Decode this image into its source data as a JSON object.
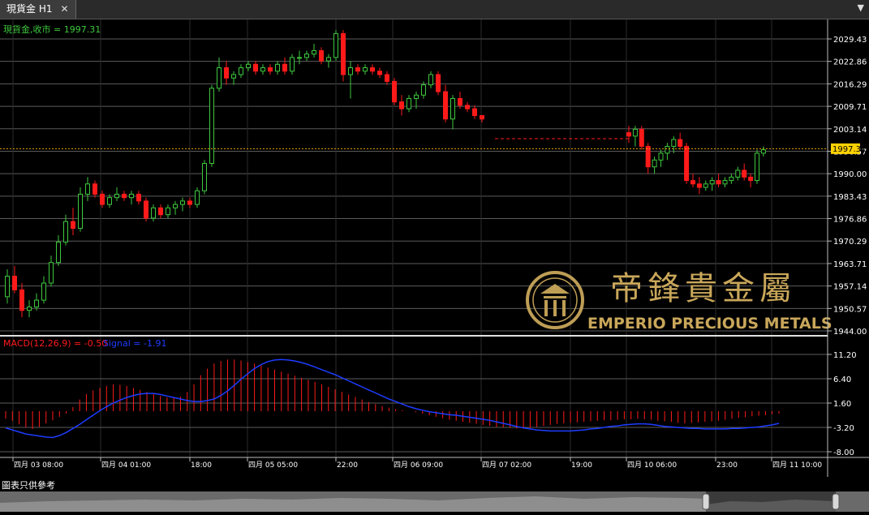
{
  "tab": {
    "title": "現貨金 H1",
    "close_glyph": "✕",
    "menu_glyph": "▼"
  },
  "main_label": "現貨金,收市 = 1997.31",
  "macd_label": {
    "name": "MACD(12,26,9) = -0.50",
    "signal": "Signal = -1.91"
  },
  "last_price_label": "1997.31",
  "price_ticks": [
    "2029.43",
    "2022.86",
    "2016.29",
    "2009.71",
    "2003.14",
    "1996.57",
    "1990.00",
    "1983.43",
    "1976.86",
    "1970.29",
    "1963.71",
    "1957.14",
    "1950.57",
    "1944.00"
  ],
  "macd_ticks": [
    "11.20",
    "6.40",
    "1.60",
    "-3.20",
    "-8.00"
  ],
  "time_labels": [
    "四月 03 08:00",
    "四月 04 01:00",
    "18:00",
    "四月 05 05:00",
    "22:00",
    "四月 06 09:00",
    "四月 07 02:00",
    "19:00",
    "四月 10 06:00",
    "23:00",
    "四月 11 10:00"
  ],
  "watermark": {
    "cn": "帝鋒貴金屬",
    "en": "EMPERIO PRECIOUS METALS"
  },
  "footer_note": "圖表只供參考",
  "colors": {
    "up": "#3ec93e",
    "down": "#ff1a1a",
    "macd_hist": "#ff1a1a",
    "signal": "#1e3cff",
    "label_green": "#3ec93e",
    "price_tag": "#ffd200",
    "gold": "#c9a75a"
  },
  "chart_data": {
    "type": "candlestick",
    "price_range": [
      1944,
      2034
    ],
    "macd_range": [
      -9.5,
      12.5
    ],
    "last_close": 1997.31,
    "ohlc": [
      [
        1954,
        1962,
        1952,
        1960
      ],
      [
        1960,
        1963,
        1955,
        1956
      ],
      [
        1956,
        1958,
        1948,
        1950
      ],
      [
        1950,
        1953,
        1948,
        1951
      ],
      [
        1951,
        1955,
        1950,
        1953
      ],
      [
        1953,
        1960,
        1952,
        1958
      ],
      [
        1958,
        1966,
        1957,
        1964
      ],
      [
        1964,
        1972,
        1963,
        1970
      ],
      [
        1970,
        1978,
        1969,
        1976
      ],
      [
        1976,
        1980,
        1972,
        1974
      ],
      [
        1974,
        1986,
        1973,
        1984
      ],
      [
        1984,
        1989,
        1982,
        1987
      ],
      [
        1987,
        1988,
        1983,
        1984
      ],
      [
        1984,
        1985,
        1980,
        1981
      ],
      [
        1981,
        1984,
        1980,
        1983
      ],
      [
        1983,
        1986,
        1982,
        1984
      ],
      [
        1984,
        1985,
        1982,
        1983
      ],
      [
        1983,
        1985,
        1981,
        1984
      ],
      [
        1984,
        1985,
        1981,
        1982
      ],
      [
        1982,
        1983,
        1976,
        1977
      ],
      [
        1977,
        1981,
        1976,
        1980
      ],
      [
        1980,
        1981,
        1977,
        1978
      ],
      [
        1978,
        1981,
        1977,
        1980
      ],
      [
        1980,
        1982,
        1978,
        1981
      ],
      [
        1981,
        1983,
        1979,
        1982
      ],
      [
        1982,
        1983,
        1980,
        1981
      ],
      [
        1981,
        1986,
        1980,
        1985
      ],
      [
        1985,
        1994,
        1984,
        1993
      ],
      [
        1993,
        2016,
        1992,
        2015
      ],
      [
        2015,
        2024,
        2014,
        2021
      ],
      [
        2021,
        2023,
        2016,
        2018
      ],
      [
        2018,
        2020,
        2016,
        2019
      ],
      [
        2019,
        2022,
        2018,
        2021
      ],
      [
        2021,
        2023,
        2020,
        2022
      ],
      [
        2022,
        2023,
        2019,
        2020
      ],
      [
        2020,
        2022,
        2019,
        2021
      ],
      [
        2021,
        2022,
        2019,
        2020
      ],
      [
        2020,
        2023,
        2019,
        2022
      ],
      [
        2022,
        2024,
        2019,
        2020
      ],
      [
        2020,
        2025,
        2019,
        2024
      ],
      [
        2024,
        2026,
        2022,
        2024
      ],
      [
        2024,
        2026,
        2023,
        2025
      ],
      [
        2025,
        2028,
        2024,
        2026
      ],
      [
        2026,
        2027,
        2022,
        2023
      ],
      [
        2023,
        2025,
        2021,
        2024
      ],
      [
        2024,
        2032,
        2023,
        2031
      ],
      [
        2031,
        2032,
        2017,
        2019
      ],
      [
        2019,
        2023,
        2012,
        2021
      ],
      [
        2021,
        2022,
        2019,
        2020
      ],
      [
        2020,
        2022,
        2019,
        2021
      ],
      [
        2021,
        2022,
        2019,
        2020
      ],
      [
        2020,
        2021,
        2018,
        2019
      ],
      [
        2019,
        2020,
        2016,
        2017
      ],
      [
        2017,
        2018,
        2010,
        2011
      ],
      [
        2011,
        2013,
        2007,
        2009
      ],
      [
        2009,
        2013,
        2008,
        2012
      ],
      [
        2012,
        2014,
        2009,
        2013
      ],
      [
        2013,
        2017,
        2012,
        2016
      ],
      [
        2016,
        2020,
        2015,
        2019
      ],
      [
        2019,
        2020,
        2013,
        2014
      ],
      [
        2014,
        2016,
        2005,
        2006
      ],
      [
        2006,
        2013,
        2003,
        2012
      ],
      [
        2012,
        2014,
        2009,
        2010
      ],
      [
        2010,
        2011,
        2008,
        2009
      ],
      [
        2009,
        2010,
        2006,
        2007
      ],
      [
        2007,
        2007,
        2005,
        2006
      ],
      [
        2002,
        2004,
        1999,
        2001
      ],
      [
        2001,
        2004,
        1998,
        2003
      ],
      [
        2003,
        2004,
        1997,
        1998
      ],
      [
        1998,
        1999,
        1990,
        1992
      ],
      [
        1992,
        1995,
        1990,
        1994
      ],
      [
        1994,
        1997,
        1992,
        1996
      ],
      [
        1996,
        1999,
        1994,
        1998
      ],
      [
        1998,
        2001,
        1996,
        2000
      ],
      [
        2000,
        2002,
        1997,
        1998
      ],
      [
        1998,
        1999,
        1987,
        1988
      ],
      [
        1988,
        1990,
        1986,
        1987
      ],
      [
        1987,
        1989,
        1984,
        1986
      ],
      [
        1986,
        1988,
        1985,
        1987
      ],
      [
        1987,
        1989,
        1985,
        1988
      ],
      [
        1988,
        1990,
        1986,
        1987
      ],
      [
        1987,
        1989,
        1986,
        1988
      ],
      [
        1988,
        1990,
        1987,
        1989
      ],
      [
        1989,
        1992,
        1988,
        1991
      ],
      [
        1991,
        1993,
        1988,
        1989
      ],
      [
        1989,
        1990,
        1986,
        1988
      ],
      [
        1988,
        1997,
        1987,
        1996
      ],
      [
        1996,
        1998,
        1995,
        1997
      ]
    ],
    "macd_hist": [
      -1.5,
      -1.9,
      -2.6,
      -3.2,
      -3.5,
      -3.1,
      -2.4,
      -1.8,
      -1.1,
      -0.5,
      0.8,
      2.3,
      3.4,
      4.1,
      4.6,
      5.0,
      5.3,
      5.2,
      5.0,
      4.6,
      4.2,
      3.8,
      3.4,
      3.0,
      2.7,
      2.6,
      2.9,
      3.8,
      5.3,
      7.1,
      8.4,
      9.4,
      9.9,
      10.2,
      10.2,
      10.0,
      9.7,
      9.4,
      9.0,
      8.6,
      8.2,
      7.8,
      7.4,
      7.0,
      6.6,
      6.2,
      5.8,
      5.3,
      4.8,
      4.3,
      3.8,
      3.3,
      2.8,
      2.3,
      1.8,
      1.4,
      1.0,
      0.7,
      0.4,
      0.2,
      0.0,
      -0.2,
      -0.5,
      -0.8,
      -1.1,
      -1.4,
      -1.7,
      -1.9,
      -2.1,
      -2.3,
      -2.5,
      -2.7,
      -2.9,
      -3.1,
      -3.2,
      -3.3,
      -3.4,
      -3.4,
      -3.3,
      -3.1,
      -2.9,
      -2.7,
      -2.5,
      -2.4,
      -2.3,
      -2.2,
      -2.1,
      -2.0,
      -1.9,
      -1.8,
      -1.8,
      -1.7,
      -1.6,
      -1.6,
      -1.5,
      -1.6,
      -1.7,
      -1.9,
      -2.0,
      -2.1,
      -2.3,
      -2.4,
      -2.3,
      -2.2,
      -2.1,
      -2.0,
      -1.9,
      -1.7,
      -1.5,
      -1.3,
      -1.2,
      -1.0,
      -0.9,
      -0.8,
      -0.6,
      -0.5
    ],
    "signal": [
      -3.3,
      -3.7,
      -4.1,
      -4.5,
      -4.7,
      -4.9,
      -5.1,
      -5.2,
      -4.8,
      -4.2,
      -3.4,
      -2.6,
      -1.7,
      -0.8,
      0.1,
      0.9,
      1.6,
      2.2,
      2.7,
      3.1,
      3.4,
      3.5,
      3.5,
      3.3,
      3.0,
      2.7,
      2.4,
      2.1,
      1.9,
      1.9,
      2.1,
      2.4,
      3.1,
      4.0,
      5.1,
      6.3,
      7.4,
      8.4,
      9.2,
      9.8,
      10.1,
      10.2,
      10.1,
      9.9,
      9.6,
      9.2,
      8.7,
      8.2,
      7.7,
      7.2,
      6.6,
      6.0,
      5.4,
      4.8,
      4.2,
      3.6,
      3.0,
      2.4,
      1.9,
      1.4,
      0.9,
      0.5,
      0.2,
      -0.1,
      -0.3,
      -0.5,
      -0.7,
      -0.8,
      -1.0,
      -1.2,
      -1.4,
      -1.6,
      -1.8,
      -2.1,
      -2.4,
      -2.7,
      -3.0,
      -3.3,
      -3.5,
      -3.7,
      -3.8,
      -3.9,
      -3.9,
      -3.9,
      -3.9,
      -3.8,
      -3.7,
      -3.5,
      -3.4,
      -3.2,
      -3.0,
      -2.9,
      -2.7,
      -2.6,
      -2.5,
      -2.5,
      -2.6,
      -2.8,
      -3.0,
      -3.1,
      -3.2,
      -3.3,
      -3.4,
      -3.4,
      -3.5,
      -3.5,
      -3.5,
      -3.5,
      -3.4,
      -3.4,
      -3.3,
      -3.2,
      -3.1,
      -2.9,
      -2.7,
      -2.4
    ]
  }
}
